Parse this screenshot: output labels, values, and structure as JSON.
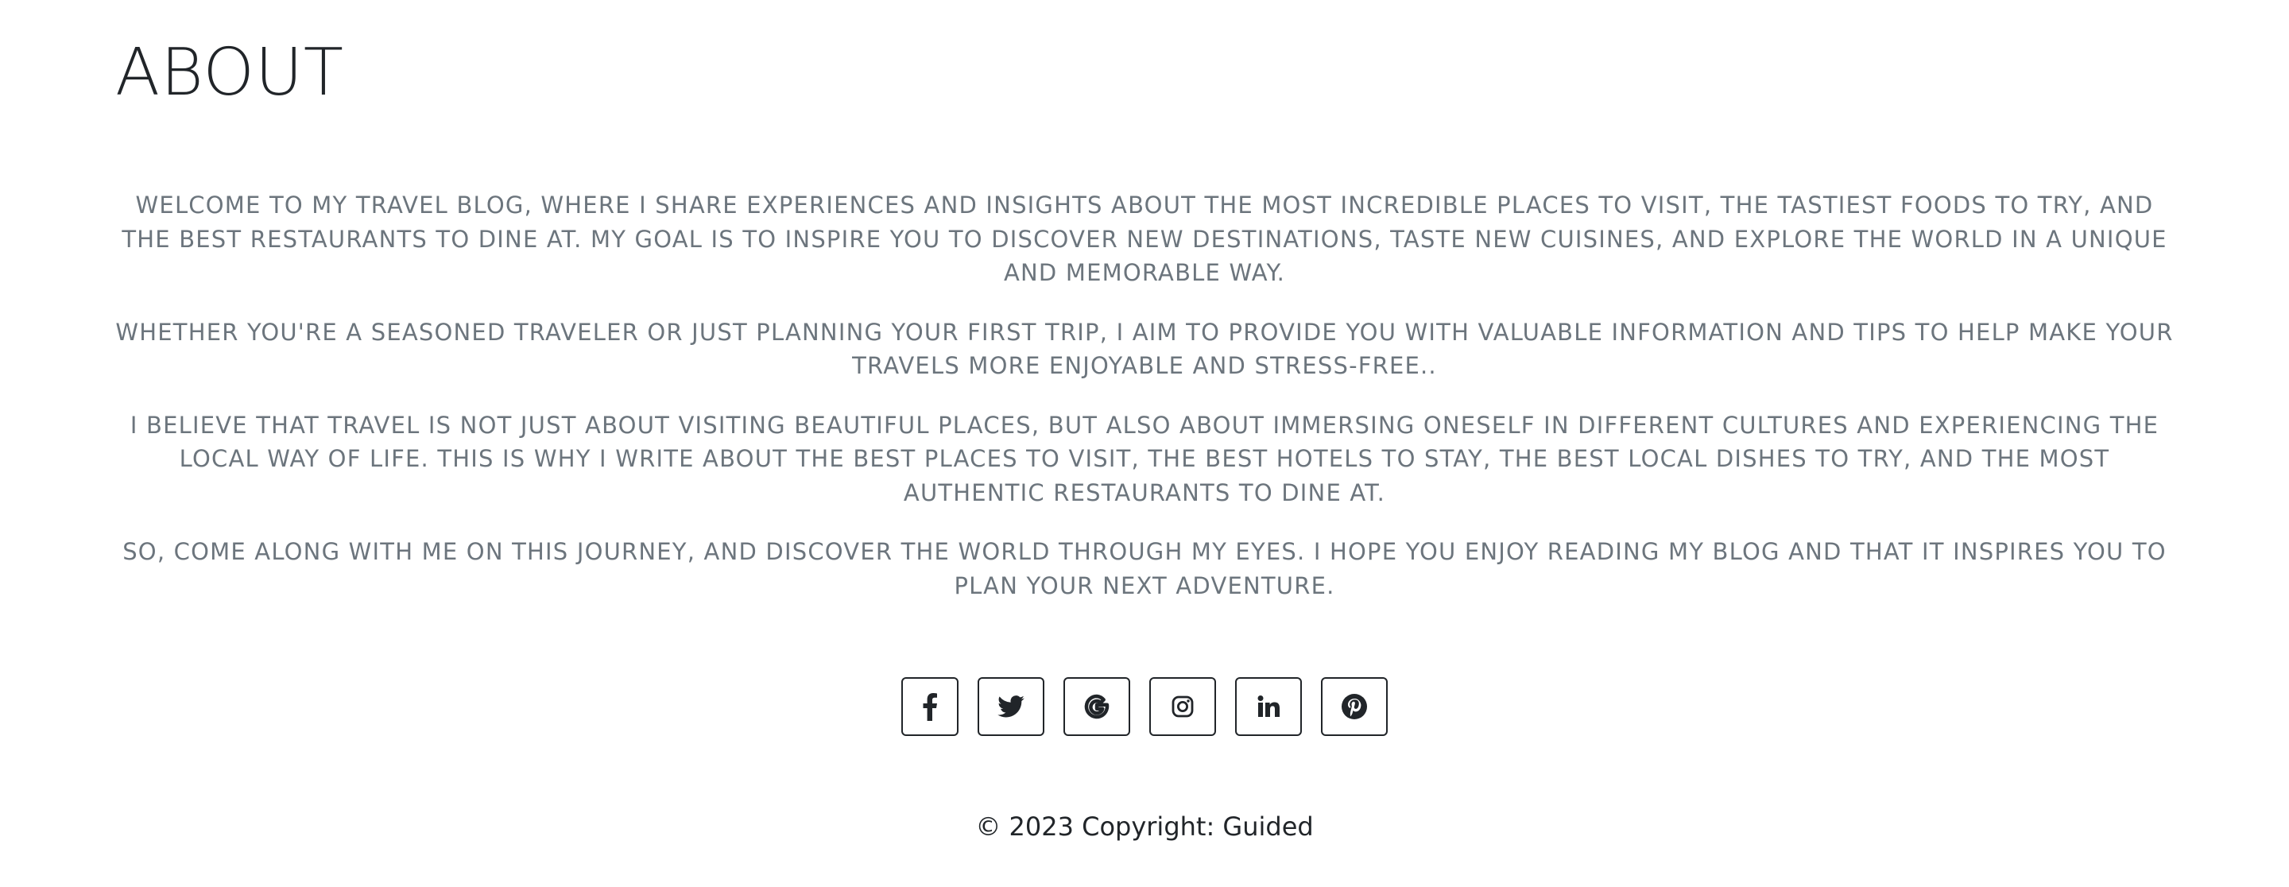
{
  "page": {
    "title": "ABOUT"
  },
  "about": {
    "paragraphs": [
      "WELCOME TO MY TRAVEL BLOG, WHERE I SHARE EXPERIENCES AND INSIGHTS ABOUT THE MOST INCREDIBLE PLACES TO VISIT, THE TASTIEST FOODS TO TRY, AND THE BEST RESTAURANTS TO DINE AT. MY GOAL IS TO INSPIRE YOU TO DISCOVER NEW DESTINATIONS, TASTE NEW CUISINES, AND EXPLORE THE WORLD IN A UNIQUE AND MEMORABLE WAY.",
      "WHETHER YOU'RE A SEASONED TRAVELER OR JUST PLANNING YOUR FIRST TRIP, I AIM TO PROVIDE YOU WITH VALUABLE INFORMATION AND TIPS TO HELP MAKE YOUR TRAVELS MORE ENJOYABLE AND STRESS-FREE..",
      "I BELIEVE THAT TRAVEL IS NOT JUST ABOUT VISITING BEAUTIFUL PLACES, BUT ALSO ABOUT IMMERSING ONESELF IN DIFFERENT CULTURES AND EXPERIENCING THE LOCAL WAY OF LIFE. THIS IS WHY I WRITE ABOUT THE BEST PLACES TO VISIT, THE BEST HOTELS TO STAY, THE BEST LOCAL DISHES TO TRY, AND THE MOST AUTHENTIC RESTAURANTS TO DINE AT.",
      "SO, COME ALONG WITH ME ON THIS JOURNEY, AND DISCOVER THE WORLD THROUGH MY EYES. I HOPE YOU ENJOY READING MY BLOG AND THAT IT INSPIRES YOU TO PLAN YOUR NEXT ADVENTURE."
    ]
  },
  "social": {
    "icons": [
      "facebook-icon",
      "twitter-icon",
      "google-icon",
      "instagram-icon",
      "linkedin-icon",
      "pinterest-icon"
    ]
  },
  "footer": {
    "copyright": "© 2023 Copyright: Guided"
  },
  "colors": {
    "heading": "#212529",
    "body_text": "#6c757d",
    "icon": "#212529",
    "background": "#ffffff"
  }
}
